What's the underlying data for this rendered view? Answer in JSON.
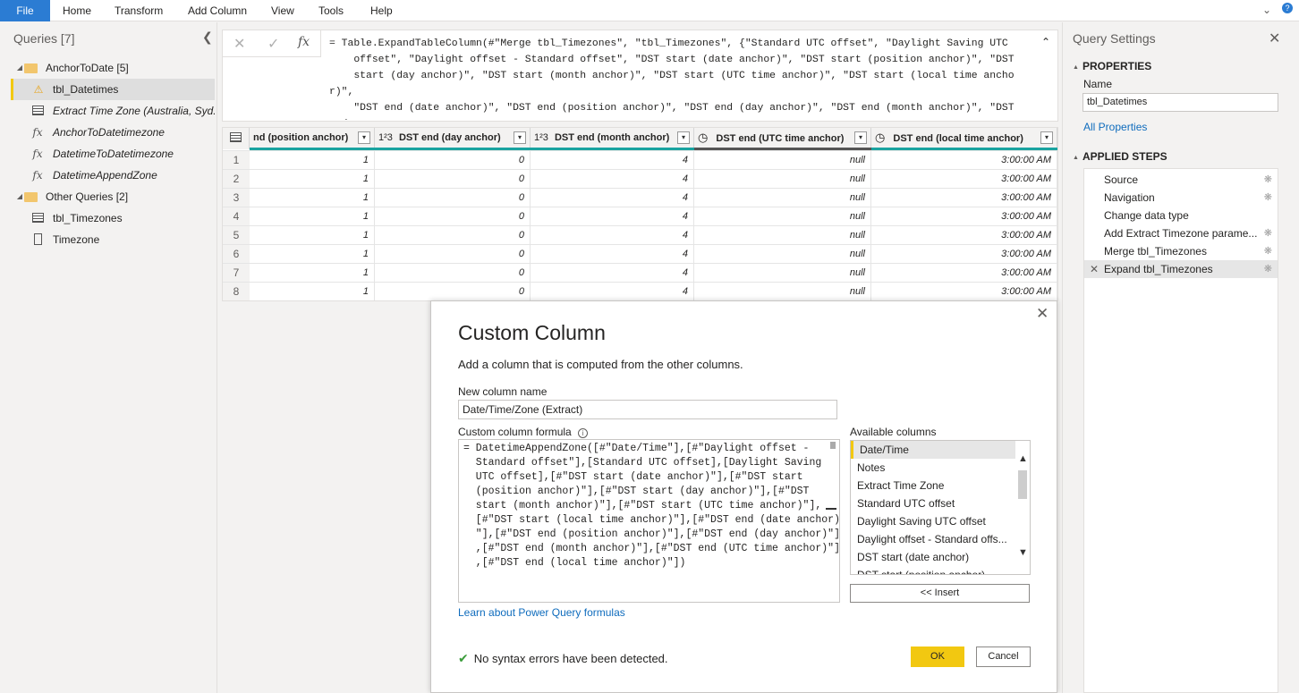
{
  "ribbon": {
    "tabs": [
      "File",
      "Home",
      "Transform",
      "Add Column",
      "View",
      "Tools",
      "Help"
    ]
  },
  "queries": {
    "header": "Queries [7]",
    "items": [
      {
        "label": "AnchorToDate [5]",
        "type": "folder"
      },
      {
        "label": "tbl_Datetimes",
        "type": "warning"
      },
      {
        "label": "Extract Time Zone (Australia, Syd...",
        "type": "table-italic"
      },
      {
        "label": "AnchorToDatetimezone",
        "type": "function"
      },
      {
        "label": "DatetimeToDatetimezone",
        "type": "function"
      },
      {
        "label": "DatetimeAppendZone",
        "type": "function"
      },
      {
        "label": "Other Queries [2]",
        "type": "folder"
      },
      {
        "label": "tbl_Timezones",
        "type": "table"
      },
      {
        "label": "Timezone",
        "type": "doc"
      }
    ]
  },
  "formula_bar": {
    "text": "= Table.ExpandTableColumn(#\"Merge tbl_Timezones\", \"tbl_Timezones\", {\"Standard UTC offset\", \"Daylight Saving UTC\n    offset\", \"Daylight offset - Standard offset\", \"DST start (date anchor)\", \"DST start (position anchor)\", \"DST\n    start (day anchor)\", \"DST start (month anchor)\", \"DST start (UTC time anchor)\", \"DST start (local time anchor)\",\n    \"DST end (date anchor)\", \"DST end (position anchor)\", \"DST end (day anchor)\", \"DST end (month anchor)\", \"DST end\n    (UTC time anchor)\", \"DST end (local time anchor)\"}, {\"Standard UTC offset\", \"Daylight Saving UTC offset\","
  },
  "grid": {
    "columns": [
      {
        "label": "nd (position anchor)",
        "type": ""
      },
      {
        "label": "DST end (day anchor)",
        "type": "1²3"
      },
      {
        "label": "DST end (month anchor)",
        "type": "1²3"
      },
      {
        "label": "DST end (UTC time anchor)",
        "type": "clock"
      },
      {
        "label": "DST end (local time anchor)",
        "type": "clock"
      }
    ],
    "rows": [
      {
        "n": "1",
        "c": [
          "1",
          "0",
          "4",
          "null",
          "3:00:00 AM"
        ]
      },
      {
        "n": "2",
        "c": [
          "1",
          "0",
          "4",
          "null",
          "3:00:00 AM"
        ]
      },
      {
        "n": "3",
        "c": [
          "1",
          "0",
          "4",
          "null",
          "3:00:00 AM"
        ]
      },
      {
        "n": "4",
        "c": [
          "1",
          "0",
          "4",
          "null",
          "3:00:00 AM"
        ]
      },
      {
        "n": "5",
        "c": [
          "1",
          "0",
          "4",
          "null",
          "3:00:00 AM"
        ]
      },
      {
        "n": "6",
        "c": [
          "1",
          "0",
          "4",
          "null",
          "3:00:00 AM"
        ]
      },
      {
        "n": "7",
        "c": [
          "1",
          "0",
          "4",
          "null",
          "3:00:00 AM"
        ]
      },
      {
        "n": "8",
        "c": [
          "1",
          "0",
          "4",
          "null",
          "3:00:00 AM"
        ]
      }
    ]
  },
  "settings": {
    "title": "Query Settings",
    "properties_label": "PROPERTIES",
    "name_label": "Name",
    "name_value": "tbl_Datetimes",
    "all_properties": "All Properties",
    "applied_steps_label": "APPLIED STEPS",
    "steps": [
      {
        "label": "Source",
        "gear": true
      },
      {
        "label": "Navigation",
        "gear": true
      },
      {
        "label": "Change data type",
        "gear": false
      },
      {
        "label": "Add Extract Timezone parame...",
        "gear": true
      },
      {
        "label": "Merge tbl_Timezones",
        "gear": true
      },
      {
        "label": "Expand tbl_Timezones",
        "gear": true
      }
    ]
  },
  "dialog": {
    "title": "Custom Column",
    "description": "Add a column that is computed from the other columns.",
    "new_column_label": "New column name",
    "new_column_value": "Date/Time/Zone (Extract)",
    "formula_label": "Custom column formula",
    "formula": "= DatetimeAppendZone([#\"Date/Time\"],[#\"Daylight offset -\n  Standard offset\"],[Standard UTC offset],[Daylight Saving\n  UTC offset],[#\"DST start (date anchor)\"],[#\"DST start\n  (position anchor)\"],[#\"DST start (day anchor)\"],[#\"DST\n  start (month anchor)\"],[#\"DST start (UTC time anchor)\"],\n  [#\"DST start (local time anchor)\"],[#\"DST end (date anchor)\n  \"],[#\"DST end (position anchor)\"],[#\"DST end (day anchor)\"]\n  ,[#\"DST end (month anchor)\"],[#\"DST end (UTC time anchor)\"]\n  ,[#\"DST end (local time anchor)\"])",
    "available_label": "Available columns",
    "available_columns": [
      "Date/Time",
      "Notes",
      "Extract Time Zone",
      "Standard UTC offset",
      "Daylight Saving UTC offset",
      "Daylight offset - Standard offs...",
      "DST start (date anchor)",
      "DST start (position anchor)"
    ],
    "insert_label": "<< Insert",
    "learn_link": "Learn about Power Query formulas",
    "status": "No syntax errors have been detected.",
    "ok_label": "OK",
    "cancel_label": "Cancel"
  },
  "colors": {
    "accent": "#f2c811",
    "file_tab": "#2b7cd3",
    "link": "#0f6cbd",
    "teal": "#1aa3a0"
  }
}
